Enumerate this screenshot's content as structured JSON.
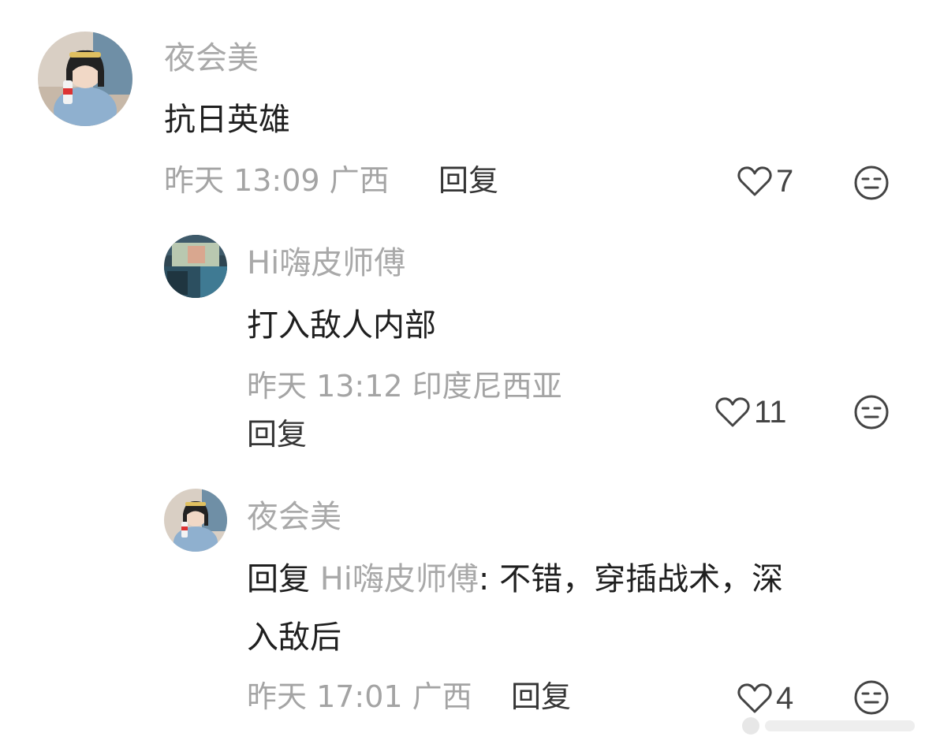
{
  "comments": [
    {
      "username": "夜会美",
      "text": "抗日英雄",
      "meta": "昨天 13:09 广西",
      "reply_label": "回复",
      "likes": "7"
    },
    {
      "username": "Hi嗨皮师傅",
      "text": "打入敌人内部",
      "meta": "昨天 13:12 印度尼西亚",
      "reply_label": "回复",
      "likes": "11"
    },
    {
      "username": "夜会美",
      "reply_prefix": "回复",
      "reply_to": "Hi嗨皮师傅",
      "text_line1": ": 不错，穿插战术，深",
      "text_line2": "入敌后",
      "meta": "昨天 17:01 广西",
      "reply_label": "回复",
      "likes": "4"
    }
  ],
  "icons": {
    "like": "heart-outline-icon",
    "dislike": "meh-face-icon"
  },
  "colors": {
    "username": "#a9a9a9",
    "text": "#1f1f1f",
    "meta": "#a4a4a4",
    "icon": "#444444"
  }
}
